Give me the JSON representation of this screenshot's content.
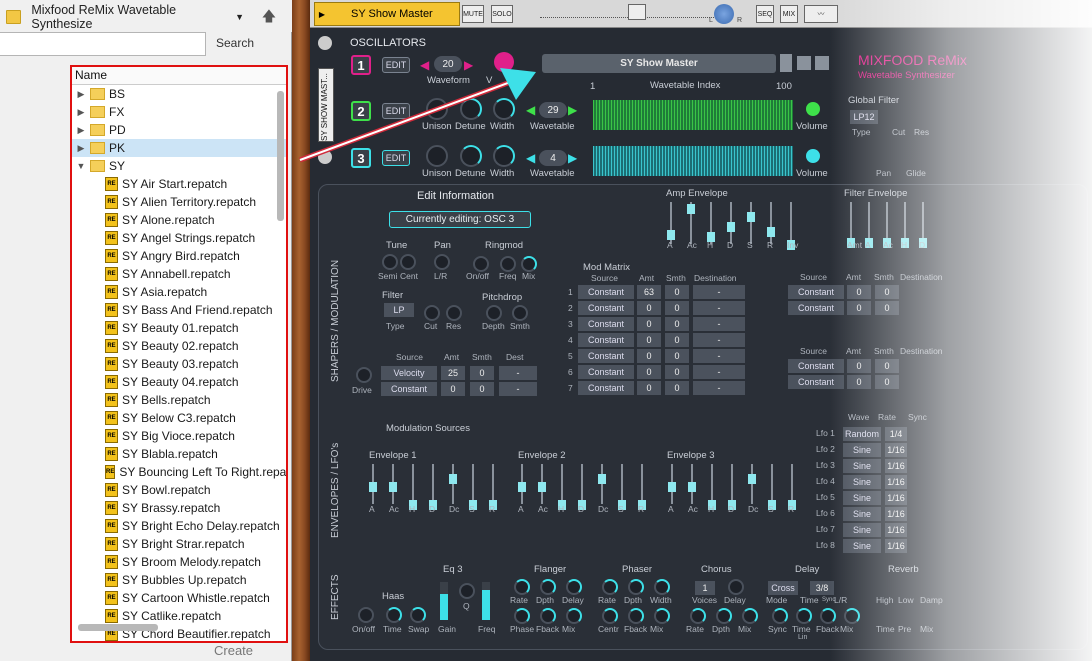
{
  "browser": {
    "folder_title": "Mixfood ReMix Wavetable Synthesize",
    "search_placeholder": "",
    "search_button": "Search",
    "column_name": "Name",
    "folders": [
      "BS",
      "FX",
      "PD",
      "PK",
      "SY"
    ],
    "files": [
      "SY Air Start.repatch",
      "SY Alien Territory.repatch",
      "SY Alone.repatch",
      "SY Angel Strings.repatch",
      "SY Angry Bird.repatch",
      "SY Annabell.repatch",
      "SY Asia.repatch",
      "SY Bass And Friend.repatch",
      "SY Beauty 01.repatch",
      "SY Beauty 02.repatch",
      "SY Beauty 03.repatch",
      "SY Beauty 04.repatch",
      "SY Bells.repatch",
      "SY Below C3.repatch",
      "SY Big Vioce.repatch",
      "SY Blabla.repatch",
      "SY Bouncing Left To Right.repatch",
      "SY Bowl.repatch",
      "SY Brassy.repatch",
      "SY Bright Echo Delay.repatch",
      "SY Bright Strar.repatch",
      "SY Broom Melody.repatch",
      "SY Bubbles Up.repatch",
      "SY Cartoon Whistle.repatch",
      "SY Catlike.repatch",
      "SY Chord Beautifier.repatch"
    ],
    "create_button": "Create"
  },
  "synth": {
    "preset_name": "SY Show Master",
    "mute": "MUTE",
    "solo": "SOLO",
    "seq": "SEQ",
    "mix": "MIX",
    "master_l": "L",
    "master_r": "R",
    "side_label": "SY SHOW MAST...",
    "oscillators_header": "OSCILLATORS",
    "osc": [
      {
        "num": "1",
        "edit": "EDIT",
        "wave_val": "20",
        "wave_label": "Waveform",
        "v_label": "V"
      },
      {
        "num": "2",
        "edit": "EDIT",
        "unison": "Unison",
        "detune": "Detune",
        "width": "Width",
        "wave_val": "29",
        "wave_label": "Wavetable",
        "volume": "Volume"
      },
      {
        "num": "3",
        "edit": "EDIT",
        "unison": "Unison",
        "detune": "Detune",
        "width": "Width",
        "wave_val": "4",
        "wave_label": "Wavetable",
        "volume": "Volume"
      }
    ],
    "preset_box": "SY Show Master",
    "wt_index_label": "Wavetable Index",
    "wt_index_min": "1",
    "wt_index_max": "100",
    "brand": "MIXFOOD ReMix",
    "brand_sub": "Wavetable Synthesizer",
    "global_filter": "Global Filter",
    "gf_type_val": "LP12",
    "gf_labels": [
      "Type",
      "Cut",
      "Res",
      "Pan",
      "Glide"
    ],
    "edit_info": "Edit Information",
    "currently_editing": "Currently editing: OSC 3",
    "shapers_modulation": "SHAPERS / MODULATION",
    "tune": "Tune",
    "tune_knobs": [
      "Semi",
      "Cent"
    ],
    "pan": "Pan",
    "pan_knob": "L/R",
    "ringmod": "Ringmod",
    "ringmod_knobs": [
      "On/off",
      "Freq",
      "Mix"
    ],
    "filter": "Filter",
    "filter_type_val": "LP",
    "filter_knobs": [
      "Type",
      "Cut",
      "Res"
    ],
    "pitchdrop": "Pitchdrop",
    "pitchdrop_knobs": [
      "Depth",
      "Smth"
    ],
    "drive": "Drive",
    "src_headers": [
      "Source",
      "Amt",
      "Smth",
      "Dest"
    ],
    "src_rows": [
      {
        "source": "Velocity",
        "amt": "25",
        "smth": "0",
        "dest": "-"
      },
      {
        "source": "Constant",
        "amt": "0",
        "smth": "0",
        "dest": "-"
      }
    ],
    "mod_matrix": "Mod Matrix",
    "mm_headers": [
      "Source",
      "Amt",
      "Smth",
      "Destination"
    ],
    "mm_rows": [
      {
        "n": "1",
        "source": "Constant",
        "amt": "63",
        "smth": "0",
        "dest": "-"
      },
      {
        "n": "2",
        "source": "Constant",
        "amt": "0",
        "smth": "0",
        "dest": "-"
      },
      {
        "n": "3",
        "source": "Constant",
        "amt": "0",
        "smth": "0",
        "dest": "-"
      },
      {
        "n": "4",
        "source": "Constant",
        "amt": "0",
        "smth": "0",
        "dest": "-"
      },
      {
        "n": "5",
        "source": "Constant",
        "amt": "0",
        "smth": "0",
        "dest": "-"
      },
      {
        "n": "6",
        "source": "Constant",
        "amt": "0",
        "smth": "0",
        "dest": "-"
      },
      {
        "n": "7",
        "source": "Constant",
        "amt": "0",
        "smth": "0",
        "dest": "-"
      }
    ],
    "amp_envelope": "Amp Envelope",
    "amp_env_labels": [
      "A",
      "Ac",
      "H",
      "D",
      "S",
      "R",
      "Inv"
    ],
    "filter_envelope": "Filter Envelope",
    "filter_env_labels": [
      "Amt",
      "A",
      "Ac",
      "H",
      "D"
    ],
    "right_src_headers": [
      "Source",
      "Amt",
      "Smth",
      "Destination"
    ],
    "right_src_rows": [
      {
        "source": "Constant",
        "amt": "0",
        "smth": "0"
      },
      {
        "source": "Constant",
        "amt": "0",
        "smth": "0"
      },
      {
        "source": "Constant",
        "amt": "0",
        "smth": "0"
      },
      {
        "source": "Constant",
        "amt": "0",
        "smth": "0"
      }
    ],
    "envelopes_lfos": "ENVELOPES / LFO's",
    "modulation_sources": "Modulation Sources",
    "env1": "Envelope 1",
    "env2": "Envelope 2",
    "env3": "Envelope 3",
    "env_labels": [
      "A",
      "Ac",
      "H",
      "D",
      "Dc",
      "S",
      "R"
    ],
    "lfo_headers": [
      "Wave",
      "Rate",
      "Sync"
    ],
    "lfos": [
      {
        "name": "Lfo 1",
        "wave": "Random",
        "rate": "1/4"
      },
      {
        "name": "Lfo 2",
        "wave": "Sine",
        "rate": "1/16"
      },
      {
        "name": "Lfo 3",
        "wave": "Sine",
        "rate": "1/16"
      },
      {
        "name": "Lfo 4",
        "wave": "Sine",
        "rate": "1/16"
      },
      {
        "name": "Lfo 5",
        "wave": "Sine",
        "rate": "1/16"
      },
      {
        "name": "Lfo 6",
        "wave": "Sine",
        "rate": "1/16"
      },
      {
        "name": "Lfo 7",
        "wave": "Sine",
        "rate": "1/16"
      },
      {
        "name": "Lfo 8",
        "wave": "Sine",
        "rate": "1/16"
      }
    ],
    "effects": "EFFECTS",
    "haas": "Haas",
    "haas_knobs": [
      "On/off",
      "Time",
      "Swap"
    ],
    "eq3": "Eq 3",
    "eq_labels": [
      "Gain",
      "Q",
      "Freq"
    ],
    "flanger": "Flanger",
    "flanger_top": [
      "Rate",
      "Dpth",
      "Delay"
    ],
    "flanger_bot": [
      "Phase",
      "Fback",
      "Mix"
    ],
    "phaser": "Phaser",
    "phaser_top": [
      "Rate",
      "Dpth",
      "Width"
    ],
    "phaser_bot": [
      "Centr",
      "Fback",
      "Mix"
    ],
    "chorus": "Chorus",
    "chorus_voices_val": "1",
    "chorus_top": [
      "Voices",
      "Delay"
    ],
    "chorus_bot": [
      "Rate",
      "Dpth",
      "Mix"
    ],
    "delay": "Delay",
    "delay_mode_val": "Cross",
    "delay_time_val": "3/8",
    "delay_top": [
      "Mode",
      "Time",
      "L/R"
    ],
    "delay_sync_small": "Sync",
    "delay_bot": [
      "Sync",
      "Time",
      "Fback",
      "Mix"
    ],
    "delay_lin": "Lin",
    "reverb": "Reverb",
    "reverb_top": [
      "High",
      "Low",
      "Damp"
    ],
    "reverb_bot": [
      "Time",
      "Pre",
      "Mix"
    ]
  },
  "colors": {
    "accent_cyan": "#3de0e8",
    "accent_magenta": "#e0208a",
    "accent_green": "#3ee04a",
    "highlight_red": "#e01010"
  }
}
